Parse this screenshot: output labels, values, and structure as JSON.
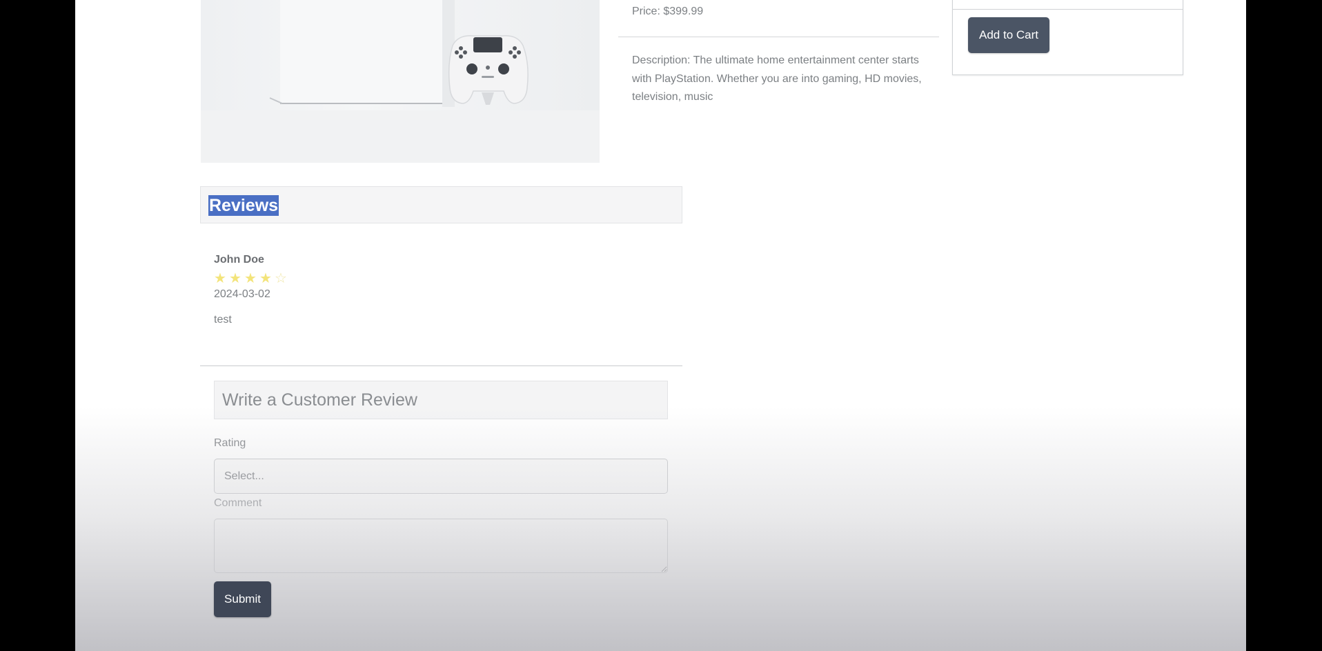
{
  "product": {
    "price": "Price: $399.99",
    "description": "Description: The ultimate home entertainment center starts with PlayStation. Whether you are into gaming, HD movies, television, music"
  },
  "cart": {
    "add_to_cart_label": "Add to Cart"
  },
  "reviews": {
    "title": "Reviews",
    "items": [
      {
        "name": "John Doe",
        "rating": 4,
        "max_rating": 5,
        "date": "2024-03-02",
        "comment": "test"
      }
    ]
  },
  "review_form": {
    "title": "Write a Customer Review",
    "rating_label": "Rating",
    "rating_selected": "Select...",
    "comment_label": "Comment",
    "comment_value": "",
    "submit_label": "Submit"
  },
  "colors": {
    "button": "#4b5565",
    "highlight": "#4a6fc4",
    "star": "#f3e47a"
  },
  "icons": {
    "star_full": "star-icon",
    "star_empty": "star-outline-icon"
  }
}
